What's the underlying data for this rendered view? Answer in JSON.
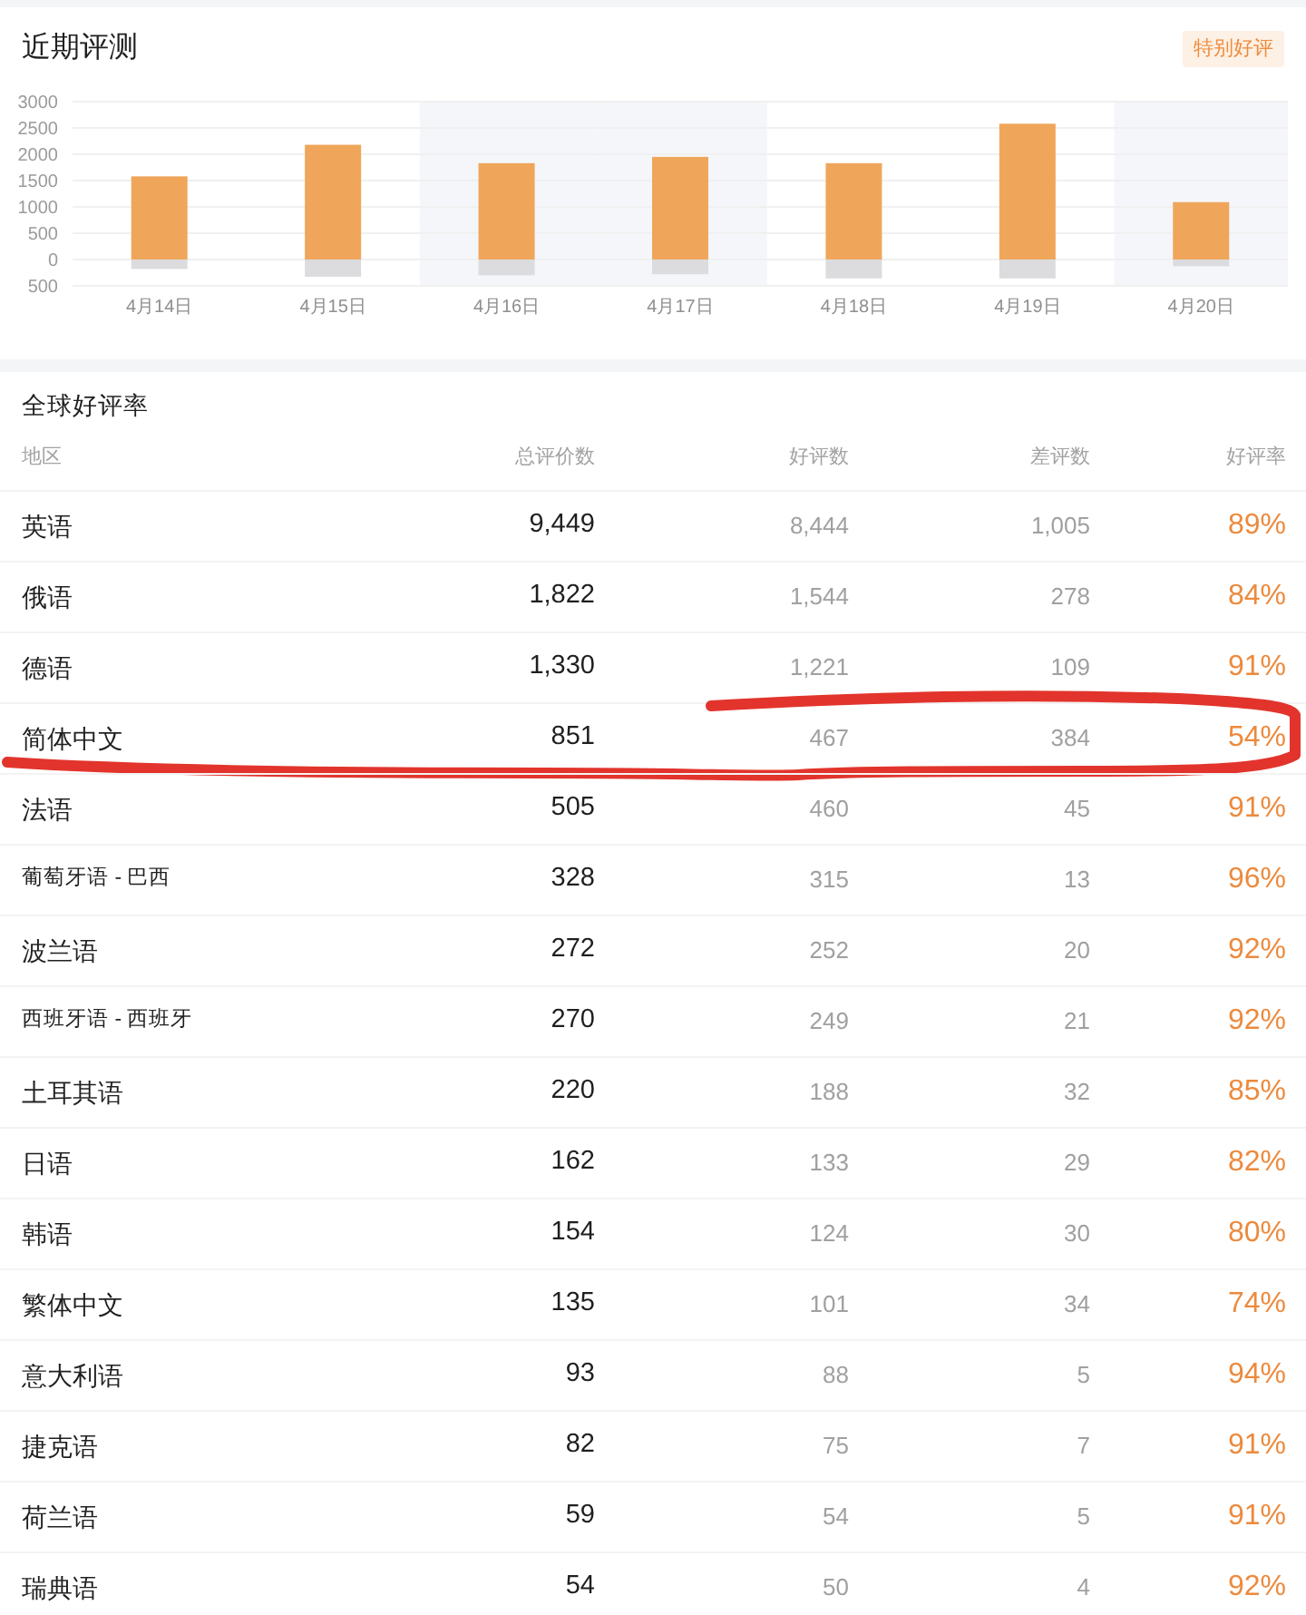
{
  "recent_reviews": {
    "title": "近期评测",
    "badge": "特别好评",
    "shaded_days": [
      false,
      false,
      true,
      true,
      false,
      false,
      true
    ],
    "chart_data": {
      "type": "bar",
      "categories": [
        "4月14日",
        "4月15日",
        "4月16日",
        "4月17日",
        "4月18日",
        "4月19日",
        "4月20日"
      ],
      "series": [
        {
          "color": "#efa65a",
          "values": [
            1580,
            2180,
            1830,
            1950,
            1830,
            2580,
            1090
          ]
        },
        {
          "color": "#dcdcde",
          "values": [
            -180,
            -330,
            -300,
            -280,
            -360,
            -360,
            -130
          ]
        }
      ],
      "ylim": [
        -500,
        3000
      ],
      "yticks": [
        {
          "value": -500,
          "label": "500"
        },
        0,
        500,
        1000,
        1500,
        2000,
        2500,
        3000
      ],
      "stacked": true,
      "grid": true
    }
  },
  "regional_ratings": {
    "title": "全球好评率",
    "columns": [
      "地区",
      "总评价数",
      "好评数",
      "差评数",
      "好评率"
    ],
    "rows": [
      {
        "region": "英语",
        "total": "9,449",
        "positive": "8,444",
        "negative": "1,005",
        "rate": "89%",
        "circled": false
      },
      {
        "region": "俄语",
        "total": "1,822",
        "positive": "1,544",
        "negative": "278",
        "rate": "84%",
        "circled": false
      },
      {
        "region": "德语",
        "total": "1,330",
        "positive": "1,221",
        "negative": "109",
        "rate": "91%",
        "circled": false
      },
      {
        "region": "简体中文",
        "total": "851",
        "positive": "467",
        "negative": "384",
        "rate": "54%",
        "circled": true
      },
      {
        "region": "法语",
        "total": "505",
        "positive": "460",
        "negative": "45",
        "rate": "91%",
        "circled": false
      },
      {
        "region": "葡萄牙语 - 巴西",
        "total": "328",
        "positive": "315",
        "negative": "13",
        "rate": "96%",
        "circled": false
      },
      {
        "region": "波兰语",
        "total": "272",
        "positive": "252",
        "negative": "20",
        "rate": "92%",
        "circled": false
      },
      {
        "region": "西班牙语 - 西班牙",
        "total": "270",
        "positive": "249",
        "negative": "21",
        "rate": "92%",
        "circled": false
      },
      {
        "region": "土耳其语",
        "total": "220",
        "positive": "188",
        "negative": "32",
        "rate": "85%",
        "circled": false
      },
      {
        "region": "日语",
        "total": "162",
        "positive": "133",
        "negative": "29",
        "rate": "82%",
        "circled": false
      },
      {
        "region": "韩语",
        "total": "154",
        "positive": "124",
        "negative": "30",
        "rate": "80%",
        "circled": false
      },
      {
        "region": "繁体中文",
        "total": "135",
        "positive": "101",
        "negative": "34",
        "rate": "74%",
        "circled": false
      },
      {
        "region": "意大利语",
        "total": "93",
        "positive": "88",
        "negative": "5",
        "rate": "94%",
        "circled": false
      },
      {
        "region": "捷克语",
        "total": "82",
        "positive": "75",
        "negative": "7",
        "rate": "91%",
        "circled": false
      },
      {
        "region": "荷兰语",
        "total": "59",
        "positive": "54",
        "negative": "5",
        "rate": "91%",
        "circled": false
      },
      {
        "region": "瑞典语",
        "total": "54",
        "positive": "50",
        "negative": "4",
        "rate": "92%",
        "circled": false
      }
    ]
  }
}
